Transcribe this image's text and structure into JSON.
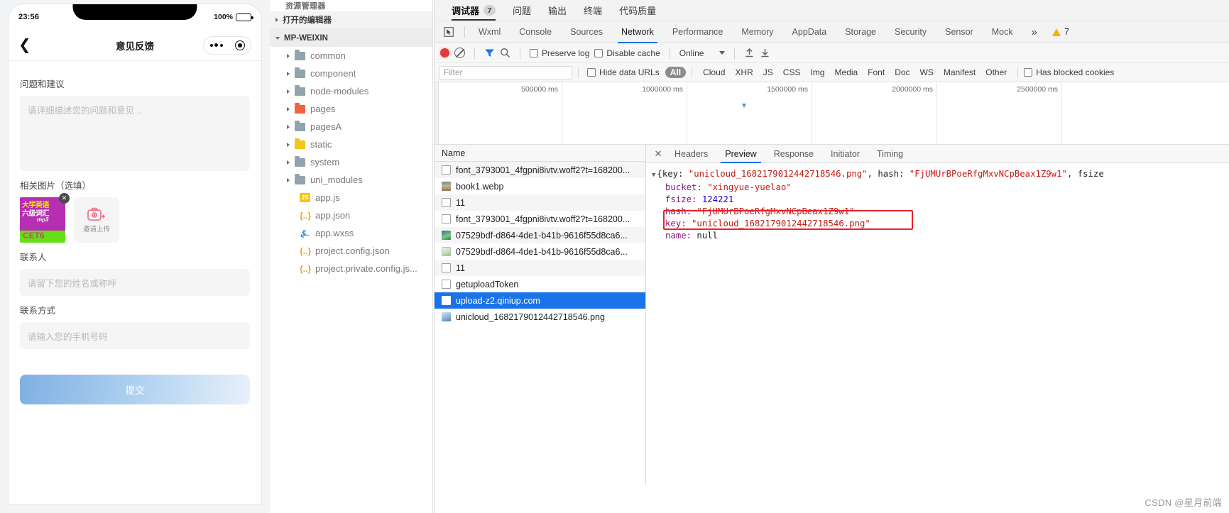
{
  "phone": {
    "status_bar": {
      "time": "23:56",
      "battery_pct": "100%"
    },
    "nav": {
      "back_icon": "chevron-left-icon",
      "title": "意见反馈",
      "more_icon": "more-dots-icon",
      "target_icon": "target-circle-icon"
    },
    "form": {
      "question_label": "问题和建议",
      "question_placeholder": "请详细描述您的问题和意见 ..",
      "images_label": "相关图片（选填）",
      "thumb_alt_lines": [
        "大学英语",
        "六级词汇",
        "mp3",
        "CET6"
      ],
      "delete_icon": "close-circle-icon",
      "upload_label": "邀请上传",
      "camera_icon": "camera-plus-icon",
      "contact_label": "联系人",
      "contact_placeholder": "请留下您的姓名或称呼",
      "phone_label": "联系方式",
      "phone_placeholder": "请输入您的手机号码",
      "submit_label": "提交"
    }
  },
  "explorer": {
    "header": "资源管理器",
    "sections": [
      {
        "label": "打开的编辑器",
        "expanded": false
      },
      {
        "label": "MP-WEIXIN",
        "expanded": true
      }
    ],
    "tree": [
      {
        "label": "common",
        "type": "folder",
        "color": "#90a4ae",
        "expanded": false
      },
      {
        "label": "component",
        "type": "folder",
        "color": "#90a4ae",
        "expanded": false
      },
      {
        "label": "node-modules",
        "type": "folder",
        "color": "#90a4ae",
        "expanded": false
      },
      {
        "label": "pages",
        "type": "folder",
        "color": "#f4613f",
        "expanded": false
      },
      {
        "label": "pagesA",
        "type": "folder",
        "color": "#90a4ae",
        "expanded": false
      },
      {
        "label": "static",
        "type": "folder",
        "color": "#f5c518",
        "expanded": false
      },
      {
        "label": "system",
        "type": "folder",
        "color": "#90a4ae",
        "expanded": false
      },
      {
        "label": "uni_modules",
        "type": "folder",
        "color": "#90a4ae",
        "expanded": false
      }
    ],
    "files": [
      {
        "label": "app.js",
        "icon": "js-file-icon"
      },
      {
        "label": "app.json",
        "icon": "json-file-icon"
      },
      {
        "label": "app.wxss",
        "icon": "css-file-icon"
      },
      {
        "label": "project.config.json",
        "icon": "json-file-icon"
      },
      {
        "label": "project.private.config.js...",
        "icon": "json-file-icon"
      }
    ]
  },
  "devtools": {
    "top_tabs": [
      {
        "label": "调试器",
        "badge": "7",
        "active": true
      },
      {
        "label": "问题",
        "badge": "",
        "active": false
      },
      {
        "label": "输出",
        "badge": "",
        "active": false
      },
      {
        "label": "终端",
        "badge": "",
        "active": false
      },
      {
        "label": "代码质量",
        "badge": "",
        "active": false
      }
    ],
    "inspect_icon": "inspect-element-icon",
    "panel_tabs": [
      {
        "label": "Wxml",
        "active": false
      },
      {
        "label": "Console",
        "active": false
      },
      {
        "label": "Sources",
        "active": false
      },
      {
        "label": "Network",
        "active": true
      },
      {
        "label": "Performance",
        "active": false
      },
      {
        "label": "Memory",
        "active": false
      },
      {
        "label": "AppData",
        "active": false
      },
      {
        "label": "Storage",
        "active": false
      },
      {
        "label": "Security",
        "active": false
      },
      {
        "label": "Sensor",
        "active": false
      },
      {
        "label": "Mock",
        "active": false
      }
    ],
    "overflow_icon": "chevron-double-right-icon",
    "warning_count": "7",
    "warning_icon": "warning-triangle-icon",
    "toolbar": {
      "record_icon": "record-stop-icon",
      "clear_icon": "clear-network-icon",
      "filter_icon": "funnel-filter-icon",
      "search_icon": "search-icon",
      "preserve_log_label": "Preserve log",
      "disable_cache_label": "Disable cache",
      "throttling_value": "Online",
      "import_icon": "upload-har-icon",
      "export_icon": "download-har-icon"
    },
    "filter_bar": {
      "filter_placeholder": "Filter",
      "hide_data_urls_label": "Hide data URLs",
      "chips": [
        "All",
        "Cloud",
        "XHR",
        "JS",
        "CSS",
        "Img",
        "Media",
        "Font",
        "Doc",
        "WS",
        "Manifest",
        "Other"
      ],
      "active_chip": "All",
      "has_blocked_cookies_label": "Has blocked cookies"
    },
    "timeline": {
      "ticks": [
        "500000 ms",
        "1000000 ms",
        "1500000 ms",
        "2000000 ms",
        "2500000 ms"
      ]
    },
    "request_list": {
      "column_header": "Name",
      "rows": [
        {
          "name": "font_3793001_4fgpni8ivtv.woff2?t=168200...",
          "icon": "doc",
          "selected": false
        },
        {
          "name": "book1.webp",
          "icon": "img1",
          "selected": false
        },
        {
          "name": "11",
          "icon": "doc",
          "selected": false
        },
        {
          "name": "font_3793001_4fgpni8ivtv.woff2?t=168200...",
          "icon": "doc",
          "selected": false
        },
        {
          "name": "07529bdf-d864-4de1-b41b-9616f55d8ca6...",
          "icon": "img2",
          "selected": false
        },
        {
          "name": "07529bdf-d864-4de1-b41b-9616f55d8ca6...",
          "icon": "img3",
          "selected": false
        },
        {
          "name": "11",
          "icon": "doc",
          "selected": false
        },
        {
          "name": "getuploadToken",
          "icon": "doc",
          "selected": false
        },
        {
          "name": "upload-z2.qiniup.com",
          "icon": "sel-ico",
          "selected": true
        },
        {
          "name": "unicloud_1682179012442718546.png",
          "icon": "png",
          "selected": false
        }
      ]
    },
    "detail": {
      "close_icon": "close-icon",
      "tabs": [
        {
          "label": "Headers",
          "active": false
        },
        {
          "label": "Preview",
          "active": true
        },
        {
          "label": "Response",
          "active": false
        },
        {
          "label": "Initiator",
          "active": false
        },
        {
          "label": "Timing",
          "active": false
        }
      ],
      "preview_json": {
        "line1_prefix": "{key: ",
        "line1_key_value": "\"unicloud_1682179012442718546.png\"",
        "line1_mid": ", hash: ",
        "line1_hash_value": "\"FjUMUrBPoeRfgMxvNCpBeax1Z9w1\"",
        "line1_suffix": ", fsize",
        "bucket_key": "bucket: ",
        "bucket_value": "\"xingyue-yuelao\"",
        "fsize_key": "fsize: ",
        "fsize_value": "124221",
        "hash_key": "hash: ",
        "hash_value": "\"FjUMUrBPoeRfgMxvNCpBeax1Z9w1\"",
        "key_key": "key: ",
        "key_value": "\"unicloud_1682179012442718546.png\"",
        "name_key": "name: ",
        "name_value": "null"
      },
      "highlight_color": "#e8222a"
    }
  },
  "watermark": "CSDN @星月前端"
}
